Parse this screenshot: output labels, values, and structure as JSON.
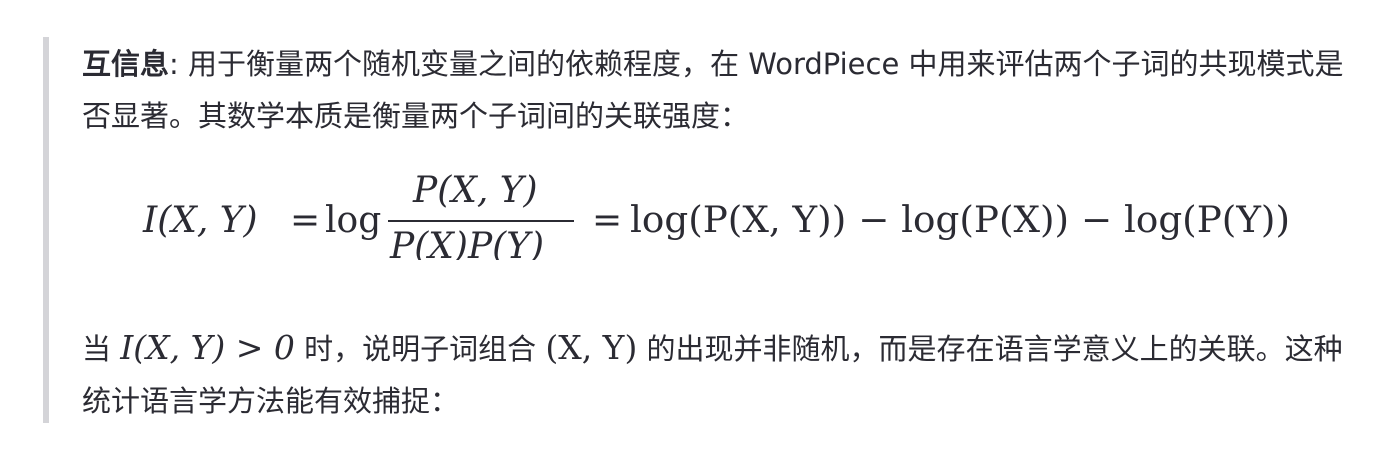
{
  "intro": {
    "term": "互信息",
    "text": ": 用于衡量两个随机变量之间的依赖程度，在 WordPiece 中用来评估两个子词的共现模式是否显著。其数学本质是衡量两个子词间的关联强度："
  },
  "formula": {
    "lhs": "I(X, Y)",
    "eq1": "=",
    "log1": "log",
    "numerator": "P(X, Y)",
    "denominator": "P(X)P(Y)",
    "eq2": "=",
    "rhs": "log(P(X, Y)) − log(P(X)) − log(P(Y))"
  },
  "para2": {
    "prefix": "当 ",
    "cond": "I(X, Y) > 0",
    "mid": " 时，说明子词组合 ",
    "pair": "(X, Y)",
    "suffix": " 的出现并非随机，而是存在语言学意义上的关联。这种统计语言学方法能有效捕捉："
  }
}
